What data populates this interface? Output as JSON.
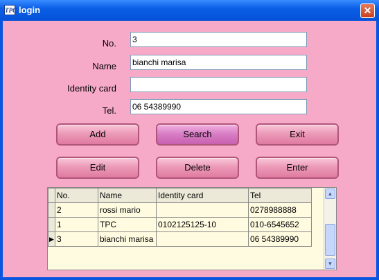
{
  "window": {
    "title": "login",
    "app_icon_text": "TPC",
    "close_glyph": "✕",
    "bg_color": "#f7aac8",
    "titlebar_color": "#0a5fe6"
  },
  "form": {
    "no_label": "No.",
    "no_value": "3",
    "name_label": "Name",
    "name_value": "bianchi marisa",
    "identity_label": "Identity card",
    "identity_value": "",
    "tel_label": "Tel.",
    "tel_value": "06 54389990"
  },
  "buttons": {
    "add": "Add",
    "search": "Search",
    "exit": "Exit",
    "edit": "Edit",
    "delete": "Delete",
    "enter": "Enter"
  },
  "grid": {
    "columns": [
      "No.",
      "Name",
      "Identity card",
      "Tel"
    ],
    "rows": [
      {
        "no": "2",
        "name": "rossi mario",
        "id": "",
        "tel": "0278988888",
        "current": false
      },
      {
        "no": "1",
        "name": "TPC",
        "id": "0102125125-10",
        "tel": "010-6545652",
        "current": false
      },
      {
        "no": "3",
        "name": "bianchi marisa",
        "id": "",
        "tel": "06 54389990",
        "current": true
      }
    ],
    "current_row_marker": "▶",
    "scroll_up_glyph": "▲",
    "scroll_down_glyph": "▼"
  }
}
